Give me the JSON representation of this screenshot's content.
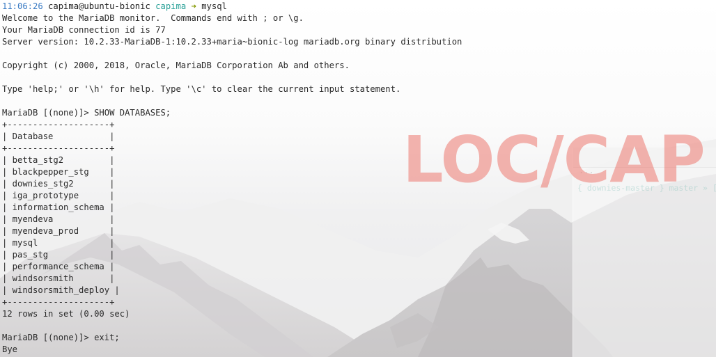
{
  "prompt": {
    "time": "11:06:26",
    "user_host": "capima@ubuntu-bionic",
    "directory": "capima",
    "arrow": "➜",
    "command": "mysql"
  },
  "output_lines": [
    "Welcome to the MariaDB monitor.  Commands end with ; or \\g.",
    "Your MariaDB connection id is 77",
    "Server version: 10.2.33-MariaDB-1:10.2.33+maria~bionic-log mariadb.org binary distribution",
    "",
    "Copyright (c) 2000, 2018, Oracle, MariaDB Corporation Ab and others.",
    "",
    "Type 'help;' or '\\h' for help. Type '\\c' to clear the current input statement.",
    "",
    "MariaDB [(none)]> SHOW DATABASES;",
    "+--------------------+",
    "| Database           |",
    "+--------------------+",
    "| betta_stg2         |",
    "| blackpepper_stg    |",
    "| downies_stg2       |",
    "| iga_prototype      |",
    "| information_schema |",
    "| myendeva           |",
    "| myendeva_prod      |",
    "| mysql              |",
    "| pas_stg            |",
    "| performance_schema |",
    "| windsorsmith       |",
    "| windsorsmith_deploy |",
    "+--------------------+",
    "12 rows in set (0.00 sec)",
    "",
    "MariaDB [(none)]> exit;",
    "Bye"
  ],
  "watermark": "LOC/CAP",
  "background_window": {
    "prompt_fragment": "{ downies-master } master » [",
    "dots": "..."
  },
  "colors": {
    "time": "#3b7cc4",
    "directory": "#2aa198",
    "arrow": "#859900",
    "text": "#2a2a2a",
    "watermark": "#ec7870"
  }
}
